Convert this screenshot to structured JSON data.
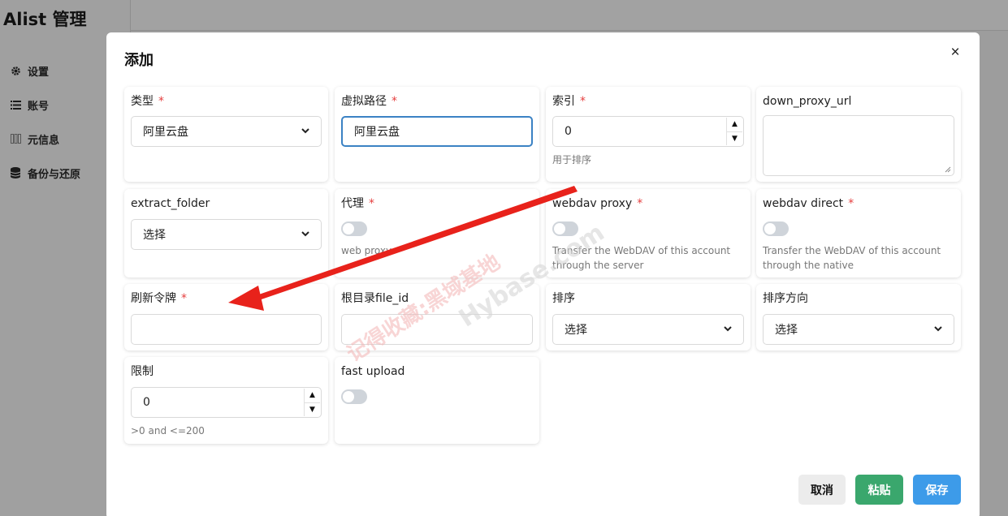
{
  "app": {
    "title": "Alist 管理",
    "nav": [
      {
        "label": "设置",
        "icon": "gear-icon"
      },
      {
        "label": "账号",
        "icon": "list-icon"
      },
      {
        "label": "元信息",
        "icon": "columns-icon"
      },
      {
        "label": "备份与还原",
        "icon": "database-icon"
      }
    ]
  },
  "modal": {
    "title": "添加",
    "close_label": "×",
    "fields": {
      "type": {
        "label": "类型",
        "required": "*",
        "value": "阿里云盘"
      },
      "virtual_path": {
        "label": "虚拟路径",
        "required": "*",
        "value": "阿里云盘"
      },
      "index": {
        "label": "索引",
        "required": "*",
        "value": "0",
        "hint": "用于排序"
      },
      "down_proxy_url": {
        "label": "down_proxy_url",
        "value": ""
      },
      "extract_folder": {
        "label": "extract_folder",
        "value": "选择"
      },
      "proxy": {
        "label": "代理",
        "required": "*",
        "hint": "web proxy",
        "checked": false
      },
      "webdav_proxy": {
        "label": "webdav proxy",
        "required": "*",
        "hint": "Transfer the WebDAV of this account through the server",
        "checked": false
      },
      "webdav_direct": {
        "label": "webdav direct",
        "required": "*",
        "hint": "Transfer the WebDAV of this account through the native",
        "checked": false
      },
      "refresh_token": {
        "label": "刷新令牌",
        "required": "*",
        "value": ""
      },
      "root_folder_file_id": {
        "label": "根目录file_id",
        "value": ""
      },
      "order_by": {
        "label": "排序",
        "value": "选择"
      },
      "order_direction": {
        "label": "排序方向",
        "value": "选择"
      },
      "limit": {
        "label": "限制",
        "value": "0",
        "hint": ">0 and <=200"
      },
      "fast_upload": {
        "label": "fast upload",
        "checked": false
      }
    },
    "buttons": {
      "cancel": "取消",
      "paste": "粘贴",
      "save": "保存"
    }
  },
  "watermark": {
    "line1": "记得收藏:黑域基地",
    "line2": "Hybase.com"
  },
  "colors": {
    "required": "#e53e3e",
    "focus": "#3b82c4",
    "paste": "#3aa76d",
    "save": "#3d9be9",
    "arrow": "#e8221b"
  }
}
